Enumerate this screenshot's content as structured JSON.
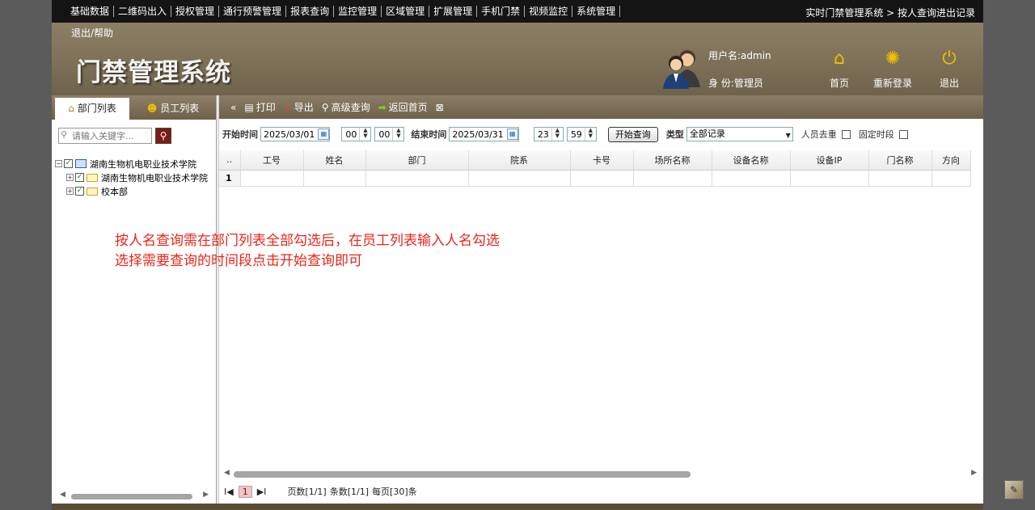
{
  "topnav": {
    "menu": [
      "基础数据",
      "二维码出入",
      "授权管理",
      "通行预警管理",
      "报表查询",
      "监控管理",
      "区域管理",
      "扩展管理",
      "手机门禁",
      "视频监控",
      "系统管理"
    ],
    "breadcrumb": "实时门禁管理系统 > 按人查询进出记录"
  },
  "header": {
    "help_link": "退出/帮助",
    "app_title": "门禁管理系统",
    "username": "用户名:admin",
    "role": "身    份:管理员",
    "home_label": "首页",
    "relogin_label": "重新登录",
    "logout_label": "退出"
  },
  "left": {
    "tab_dept": "部门列表",
    "tab_staff": "员工列表",
    "search_placeholder": "请输入关键字...",
    "tree": {
      "root": "湖南生物机电职业技术学院",
      "child1": "湖南生物机电职业技术学院",
      "child2": "校本部"
    }
  },
  "toolbar": {
    "collapse": "«",
    "print": "打印",
    "export": "导出",
    "advanced": "高级查询",
    "back_home": "返回首页"
  },
  "filter": {
    "start_label": "开始时间",
    "start_date": "2025/03/01",
    "start_hour": "00",
    "start_min": "00",
    "end_label": "结束时间",
    "end_date": "2025/03/31",
    "end_hour": "23",
    "end_min": "59",
    "query_button": "开始查询",
    "type_label": "类型",
    "type_value": "全部记录",
    "dedupe_label": "人员去重",
    "fixed_label": "固定时段"
  },
  "grid": {
    "columns": [
      "..",
      "工号",
      "姓名",
      "部门",
      "院系",
      "卡号",
      "场所名称",
      "设备名称",
      "设备IP",
      "门名称",
      "方向"
    ],
    "rows": [
      [
        "1",
        "",
        "",
        "",
        "",
        "",
        "",
        "",
        "",
        "",
        ""
      ]
    ]
  },
  "annotation": {
    "line1": "按人名查询需在部门列表全部勾选后，在员工列表输入人名勾选",
    "line2": "选择需要查询的时间段点击开始查询即可"
  },
  "pager": {
    "first": "I◀",
    "current_page": "1",
    "last": "▶I",
    "pages": "页数[1/1]",
    "count": "条数[1/1]",
    "per_page": "每页[30]条"
  },
  "colors": {
    "banner": "#7d6f56",
    "nav_bg": "#141414",
    "annotation": "#e8261a",
    "accent_icon": "#f0c000"
  }
}
